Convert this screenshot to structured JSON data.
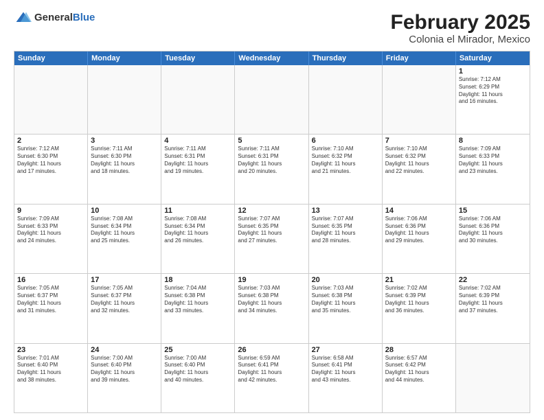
{
  "header": {
    "logo": {
      "general": "General",
      "blue": "Blue"
    },
    "title": "February 2025",
    "subtitle": "Colonia el Mirador, Mexico"
  },
  "calendar": {
    "days": [
      "Sunday",
      "Monday",
      "Tuesday",
      "Wednesday",
      "Thursday",
      "Friday",
      "Saturday"
    ],
    "rows": [
      [
        {
          "day": "",
          "text": ""
        },
        {
          "day": "",
          "text": ""
        },
        {
          "day": "",
          "text": ""
        },
        {
          "day": "",
          "text": ""
        },
        {
          "day": "",
          "text": ""
        },
        {
          "day": "",
          "text": ""
        },
        {
          "day": "1",
          "text": "Sunrise: 7:12 AM\nSunset: 6:29 PM\nDaylight: 11 hours\nand 16 minutes."
        }
      ],
      [
        {
          "day": "2",
          "text": "Sunrise: 7:12 AM\nSunset: 6:30 PM\nDaylight: 11 hours\nand 17 minutes."
        },
        {
          "day": "3",
          "text": "Sunrise: 7:11 AM\nSunset: 6:30 PM\nDaylight: 11 hours\nand 18 minutes."
        },
        {
          "day": "4",
          "text": "Sunrise: 7:11 AM\nSunset: 6:31 PM\nDaylight: 11 hours\nand 19 minutes."
        },
        {
          "day": "5",
          "text": "Sunrise: 7:11 AM\nSunset: 6:31 PM\nDaylight: 11 hours\nand 20 minutes."
        },
        {
          "day": "6",
          "text": "Sunrise: 7:10 AM\nSunset: 6:32 PM\nDaylight: 11 hours\nand 21 minutes."
        },
        {
          "day": "7",
          "text": "Sunrise: 7:10 AM\nSunset: 6:32 PM\nDaylight: 11 hours\nand 22 minutes."
        },
        {
          "day": "8",
          "text": "Sunrise: 7:09 AM\nSunset: 6:33 PM\nDaylight: 11 hours\nand 23 minutes."
        }
      ],
      [
        {
          "day": "9",
          "text": "Sunrise: 7:09 AM\nSunset: 6:33 PM\nDaylight: 11 hours\nand 24 minutes."
        },
        {
          "day": "10",
          "text": "Sunrise: 7:08 AM\nSunset: 6:34 PM\nDaylight: 11 hours\nand 25 minutes."
        },
        {
          "day": "11",
          "text": "Sunrise: 7:08 AM\nSunset: 6:34 PM\nDaylight: 11 hours\nand 26 minutes."
        },
        {
          "day": "12",
          "text": "Sunrise: 7:07 AM\nSunset: 6:35 PM\nDaylight: 11 hours\nand 27 minutes."
        },
        {
          "day": "13",
          "text": "Sunrise: 7:07 AM\nSunset: 6:35 PM\nDaylight: 11 hours\nand 28 minutes."
        },
        {
          "day": "14",
          "text": "Sunrise: 7:06 AM\nSunset: 6:36 PM\nDaylight: 11 hours\nand 29 minutes."
        },
        {
          "day": "15",
          "text": "Sunrise: 7:06 AM\nSunset: 6:36 PM\nDaylight: 11 hours\nand 30 minutes."
        }
      ],
      [
        {
          "day": "16",
          "text": "Sunrise: 7:05 AM\nSunset: 6:37 PM\nDaylight: 11 hours\nand 31 minutes."
        },
        {
          "day": "17",
          "text": "Sunrise: 7:05 AM\nSunset: 6:37 PM\nDaylight: 11 hours\nand 32 minutes."
        },
        {
          "day": "18",
          "text": "Sunrise: 7:04 AM\nSunset: 6:38 PM\nDaylight: 11 hours\nand 33 minutes."
        },
        {
          "day": "19",
          "text": "Sunrise: 7:03 AM\nSunset: 6:38 PM\nDaylight: 11 hours\nand 34 minutes."
        },
        {
          "day": "20",
          "text": "Sunrise: 7:03 AM\nSunset: 6:38 PM\nDaylight: 11 hours\nand 35 minutes."
        },
        {
          "day": "21",
          "text": "Sunrise: 7:02 AM\nSunset: 6:39 PM\nDaylight: 11 hours\nand 36 minutes."
        },
        {
          "day": "22",
          "text": "Sunrise: 7:02 AM\nSunset: 6:39 PM\nDaylight: 11 hours\nand 37 minutes."
        }
      ],
      [
        {
          "day": "23",
          "text": "Sunrise: 7:01 AM\nSunset: 6:40 PM\nDaylight: 11 hours\nand 38 minutes."
        },
        {
          "day": "24",
          "text": "Sunrise: 7:00 AM\nSunset: 6:40 PM\nDaylight: 11 hours\nand 39 minutes."
        },
        {
          "day": "25",
          "text": "Sunrise: 7:00 AM\nSunset: 6:40 PM\nDaylight: 11 hours\nand 40 minutes."
        },
        {
          "day": "26",
          "text": "Sunrise: 6:59 AM\nSunset: 6:41 PM\nDaylight: 11 hours\nand 42 minutes."
        },
        {
          "day": "27",
          "text": "Sunrise: 6:58 AM\nSunset: 6:41 PM\nDaylight: 11 hours\nand 43 minutes."
        },
        {
          "day": "28",
          "text": "Sunrise: 6:57 AM\nSunset: 6:42 PM\nDaylight: 11 hours\nand 44 minutes."
        },
        {
          "day": "",
          "text": ""
        }
      ]
    ]
  }
}
